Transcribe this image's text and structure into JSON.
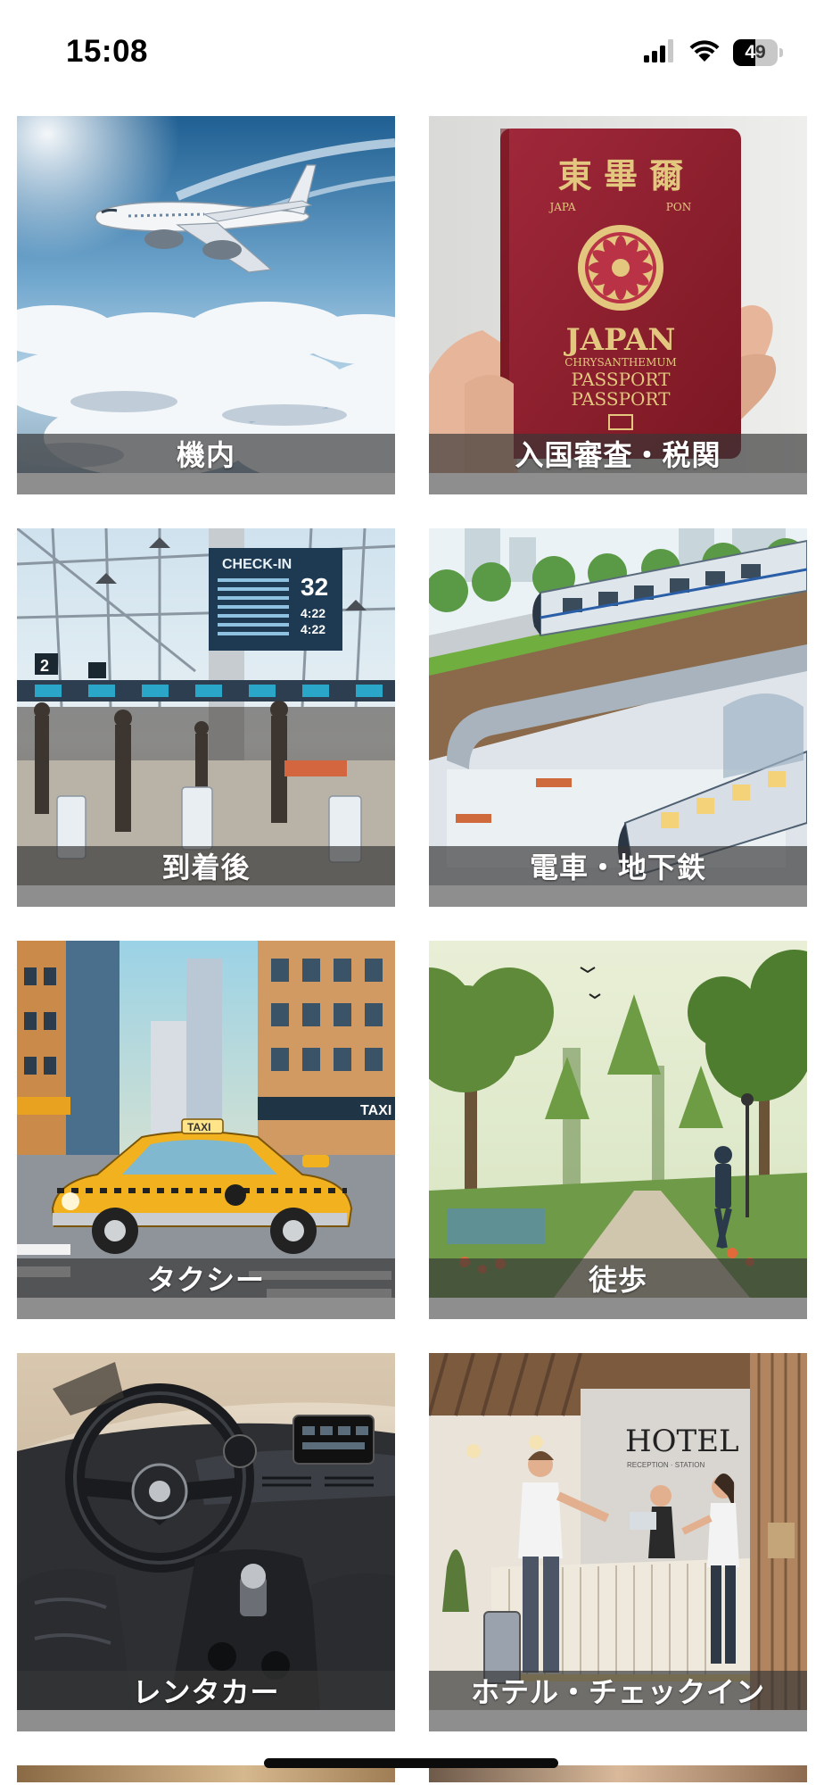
{
  "status_bar": {
    "time": "15:08",
    "battery_level": "49",
    "icons": [
      "cellular-signal-icon",
      "wifi-icon",
      "battery-icon"
    ]
  },
  "categories": [
    {
      "label": "機内",
      "image": "airplane-above-clouds"
    },
    {
      "label": "入国審査・税関",
      "image": "passport-in-hand"
    },
    {
      "label": "到着後",
      "image": "airport-check-in-hall"
    },
    {
      "label": "電車・地下鉄",
      "image": "train-and-subway"
    },
    {
      "label": "タクシー",
      "image": "yellow-taxi-in-city"
    },
    {
      "label": "徒歩",
      "image": "walking-in-park"
    },
    {
      "label": "レンタカー",
      "image": "car-interior"
    },
    {
      "label": "ホテル・チェックイン",
      "image": "hotel-reception"
    }
  ],
  "passport_text": {
    "kanji": "東 畢 爾",
    "japa": "JAPA",
    "pon": "PON",
    "title": "JAPAN",
    "line1": "CHRYSANTHEMUM",
    "line2": "PASSPORT",
    "line3": "PASSPORT"
  },
  "board_text": {
    "checkin": "CHECK-IN",
    "num1": "32",
    "num2": "4:22",
    "num3": "4:22",
    "gate": "2"
  },
  "taxi_text": {
    "roof": "TAXI",
    "store": "TAXI"
  },
  "hotel_text": {
    "sign": "HOTEL",
    "sub": "RECEPTION · STATION"
  },
  "colors": {
    "caption_bg": "#373737",
    "card_base": "#8e8e8e",
    "passport_red": "#8e1f2c",
    "taxi_yellow": "#f2b21f"
  }
}
